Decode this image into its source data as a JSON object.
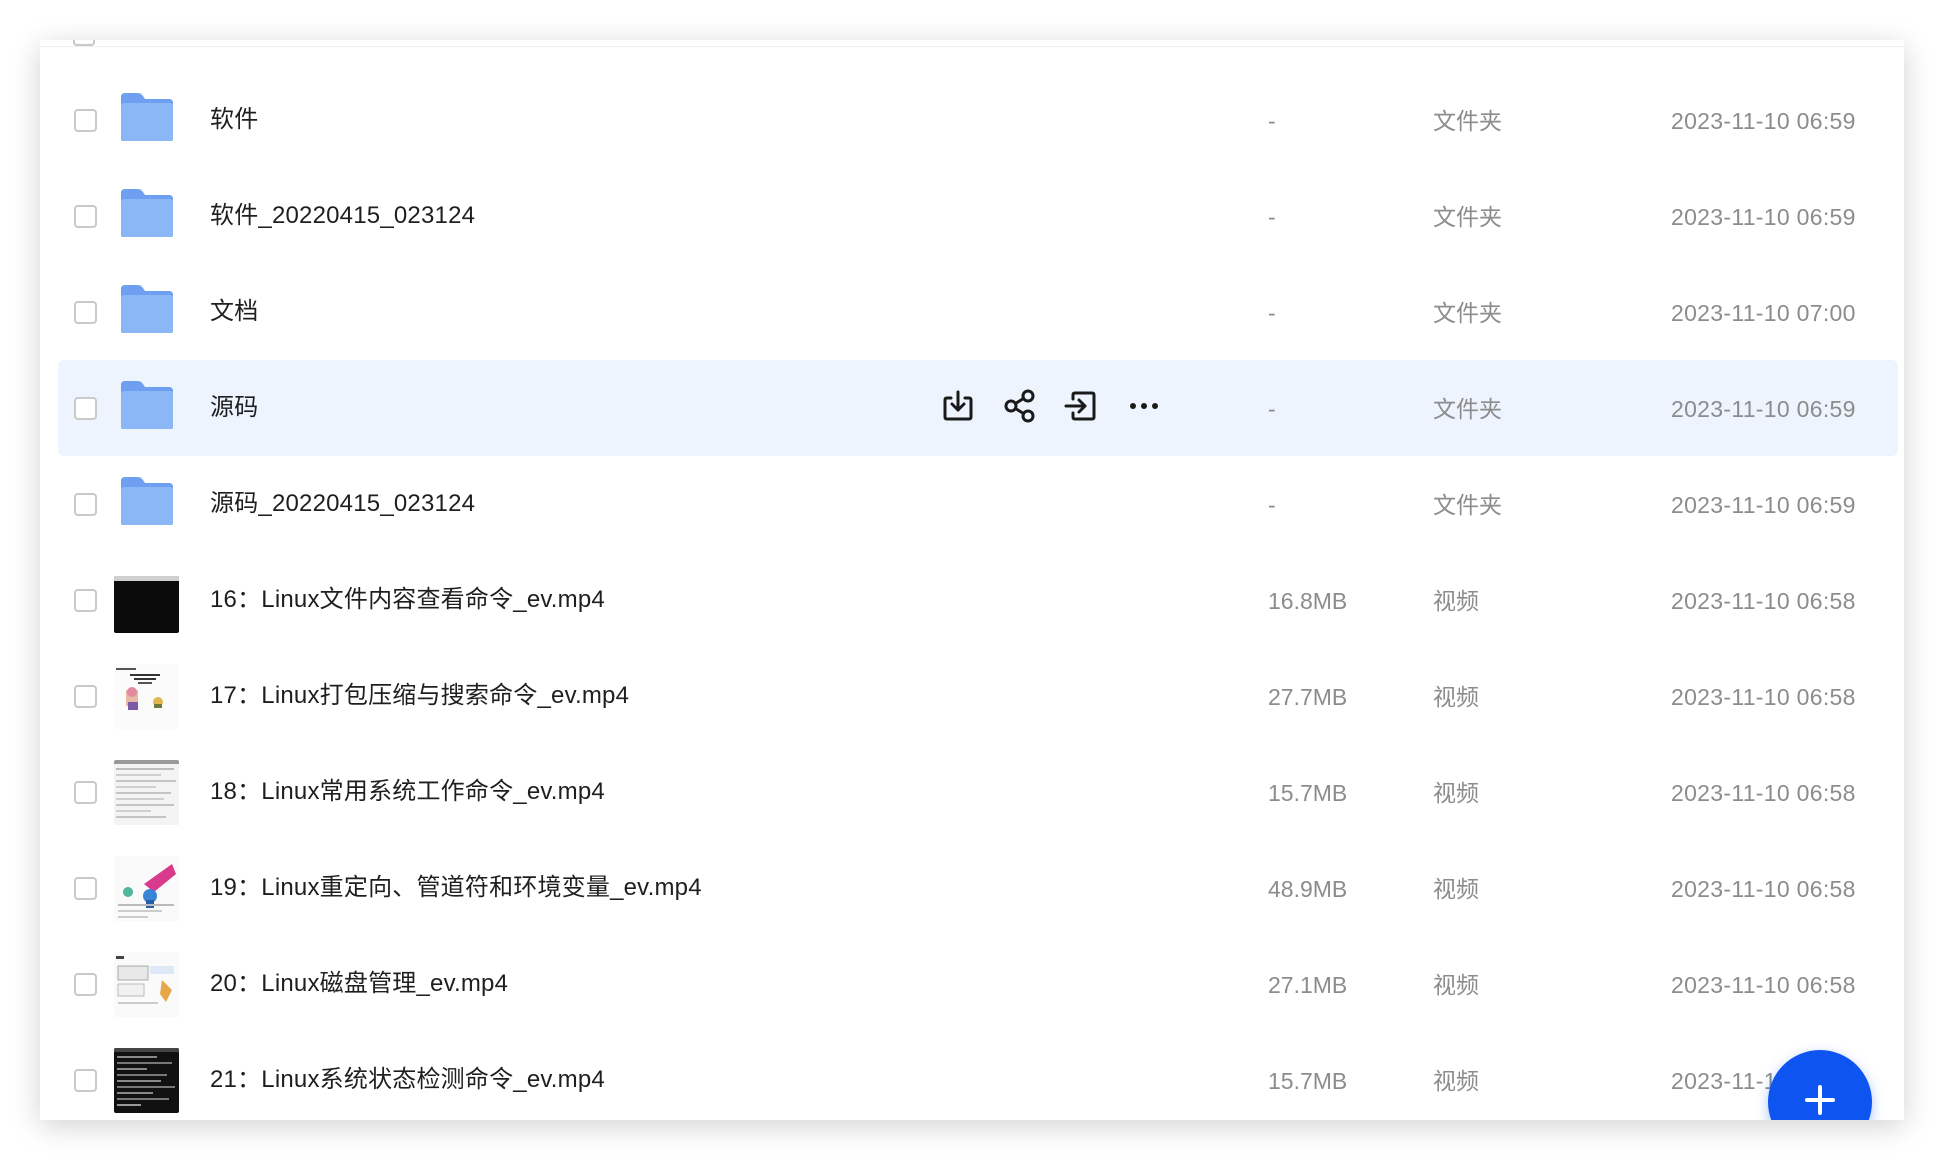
{
  "files": [
    {
      "name": "软件",
      "size": "-",
      "type": "文件夹",
      "date": "2023-11-10 06:59",
      "kind": "folder"
    },
    {
      "name": "软件_20220415_023124",
      "size": "-",
      "type": "文件夹",
      "date": "2023-11-10 06:59",
      "kind": "folder"
    },
    {
      "name": "文档",
      "size": "-",
      "type": "文件夹",
      "date": "2023-11-10 07:00",
      "kind": "folder"
    },
    {
      "name": "源码",
      "size": "-",
      "type": "文件夹",
      "date": "2023-11-10 06:59",
      "kind": "folder",
      "hovered": true
    },
    {
      "name": "源码_20220415_023124",
      "size": "-",
      "type": "文件夹",
      "date": "2023-11-10 06:59",
      "kind": "folder"
    },
    {
      "name": "16：Linux文件内容查看命令_ev.mp4",
      "size": "16.8MB",
      "type": "视频",
      "date": "2023-11-10 06:58",
      "kind": "video"
    },
    {
      "name": "17：Linux打包压缩与搜索命令_ev.mp4",
      "size": "27.7MB",
      "type": "视频",
      "date": "2023-11-10 06:58",
      "kind": "video"
    },
    {
      "name": "18：Linux常用系统工作命令_ev.mp4",
      "size": "15.7MB",
      "type": "视频",
      "date": "2023-11-10 06:58",
      "kind": "video"
    },
    {
      "name": "19：Linux重定向、管道符和环境变量_ev.mp4",
      "size": "48.9MB",
      "type": "视频",
      "date": "2023-11-10 06:58",
      "kind": "video"
    },
    {
      "name": "20：Linux磁盘管理_ev.mp4",
      "size": "27.1MB",
      "type": "视频",
      "date": "2023-11-10 06:58",
      "kind": "video"
    },
    {
      "name": "21：Linux系统状态检测命令_ev.mp4",
      "size": "15.7MB",
      "type": "视频",
      "date": "2023-11-10 06:58",
      "kind": "video"
    }
  ],
  "row_actions": [
    {
      "icon": "download-icon"
    },
    {
      "icon": "share-icon"
    },
    {
      "icon": "move-icon"
    },
    {
      "icon": "more-icon"
    }
  ],
  "fab": {
    "icon": "plus-icon"
  },
  "colors": {
    "accent": "#0d54f0",
    "folder": "#7aaef5",
    "hover_row": "#eef4fe"
  }
}
